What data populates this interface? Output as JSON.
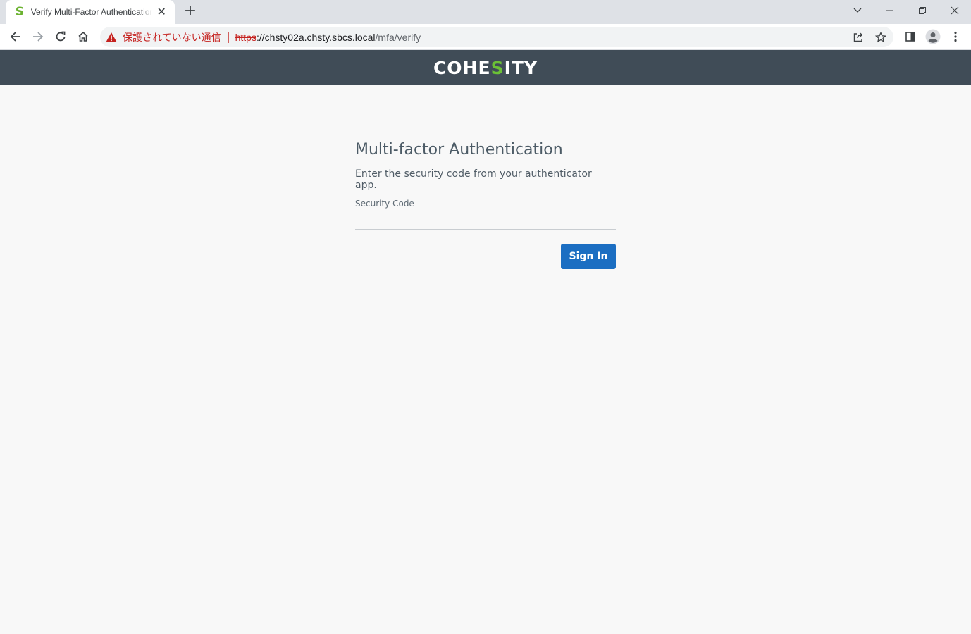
{
  "browser": {
    "tab": {
      "favicon": "S",
      "title": "Verify Multi-Factor Authentication",
      "close_icon": "close-icon"
    },
    "new_tab_label": "+",
    "omnibox": {
      "security_label": "保護されていない通信",
      "url_scheme": "https",
      "url_host": "://chsty02a.chsty.sbcs.local",
      "url_path": "/mfa/verify"
    },
    "icons": [
      "back-icon",
      "forward-icon",
      "reload-icon",
      "home-icon",
      "warning-icon",
      "share-icon",
      "star-icon",
      "side-panel-icon",
      "profile-icon",
      "menu-icon",
      "tab-search-icon",
      "minimize-icon",
      "restore-icon",
      "close-window-icon"
    ],
    "colors": {
      "insecure": "#c5221f",
      "tabstrip": "#dee1e6"
    }
  },
  "app": {
    "logo": {
      "part1": "COHE",
      "accent": "S",
      "part2": "ITY"
    },
    "colors": {
      "header": "#404c57",
      "accent": "#6bc136",
      "primary_button": "#1b6ec2"
    }
  },
  "mfa": {
    "title": "Multi-factor Authentication",
    "instruction": "Enter the security code from your authenticator app.",
    "code_label": "Security Code",
    "code_value": "",
    "sign_in_label": "Sign In"
  }
}
